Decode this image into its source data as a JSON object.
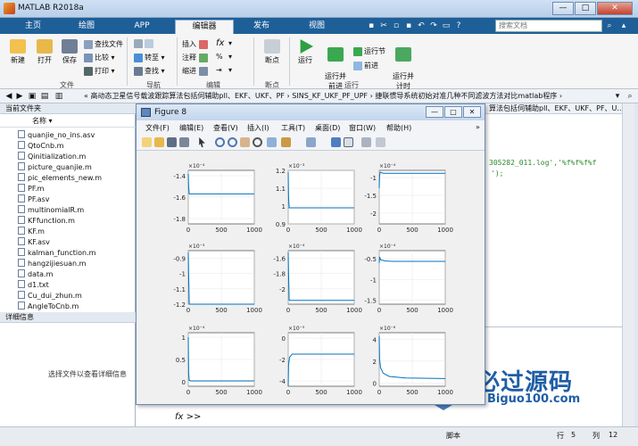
{
  "app": {
    "title": "MATLAB R2018a"
  },
  "window_controls": {
    "minimize": "—",
    "maximize": "□",
    "close": "✕"
  },
  "tabs": [
    {
      "label": "主页"
    },
    {
      "label": "绘图"
    },
    {
      "label": "APP"
    },
    {
      "label": "编辑器"
    },
    {
      "label": "发布"
    },
    {
      "label": "视图"
    }
  ],
  "search": {
    "placeholder": "搜索文档"
  },
  "ribbon": {
    "file": {
      "new": "新建",
      "open": "打开",
      "save": "保存",
      "find_files": "查找文件",
      "compare": "比较",
      "print": "打印",
      "group": "文件"
    },
    "navigate": {
      "goto": "转至",
      "find": "查找",
      "group": "导航"
    },
    "edit": {
      "insert": "插入",
      "comment": "注释",
      "indent": "缩进",
      "fx": "fx",
      "group": "编辑"
    },
    "breakpoints": {
      "label": "断点",
      "group": "断点"
    },
    "run": {
      "run": "运行",
      "run_advance": "运行并\n前进",
      "run_section": "运行节",
      "advance": "前进",
      "run_time": "运行并\n计时",
      "group": "运行"
    }
  },
  "address": {
    "path": "« 高动态卫星信号载波跟踪算法包括伺辅助pll、EKF、UKF、PF › SINS_KF_UKF_PF_UPF › 捷联惯导系统初始对准几种不同滤波方法对比matlab程序 ›"
  },
  "editor_header": "算法包括伺辅助pll、EKF、UKF、PF、U...",
  "current_folder": {
    "header": "当前文件夹",
    "column": "名称",
    "files": [
      "quanjie_no_ins.asv",
      "QtoCnb.m",
      "Qinitialization.m",
      "picture_quanjie.m",
      "pic_elements_new.m",
      "PF.m",
      "PF.asv",
      "multinomialR.m",
      "KFfunction.m",
      "KF.m",
      "KF.asv",
      "kalman_function.m",
      "hangzijiesuan.m",
      "data.m",
      "d1.txt",
      "Cu_dui_zhun.m",
      "AngleToCnb.m"
    ]
  },
  "details": {
    "header": "详细信息",
    "message": "选择文件以查看详细信息"
  },
  "editor_code": [
    "305282_011.log','%f%f%f%f",
    "');"
  ],
  "command": {
    "prompt": ">>",
    "fx": "fx"
  },
  "status": {
    "script": "脚本",
    "row_label": "行",
    "row": "5",
    "col_label": "列",
    "col": "12"
  },
  "figure": {
    "title": "Figure 8",
    "menu": [
      "文件(F)",
      "编辑(E)",
      "查看(V)",
      "插入(I)",
      "工具(T)",
      "桌面(D)",
      "窗口(W)",
      "帮助(H)"
    ]
  },
  "chart_data": [
    {
      "type": "line",
      "exponent": "×10⁻⁴",
      "yticks": [
        "-1.4",
        "-1.6",
        "-1.8"
      ],
      "xticks": [
        "0",
        "500",
        "1000"
      ],
      "ylim": [
        -1.85,
        -1.35
      ],
      "xlim": [
        0,
        1000
      ],
      "series": [
        {
          "x": [
            0,
            5,
            15,
            40,
            1000
          ],
          "y": [
            -1.38,
            -1.5,
            -1.57,
            -1.57,
            -1.57
          ]
        }
      ]
    },
    {
      "type": "line",
      "exponent": "×10⁻³",
      "yticks": [
        "1.2",
        "1.1",
        "1",
        "0.9"
      ],
      "xticks": [
        "0",
        "500",
        "1000"
      ],
      "ylim": [
        0.9,
        1.2
      ],
      "xlim": [
        0,
        1000
      ],
      "series": [
        {
          "x": [
            0,
            5,
            15,
            40,
            1000
          ],
          "y": [
            1.19,
            1.05,
            0.99,
            0.99,
            0.99
          ]
        }
      ]
    },
    {
      "type": "line",
      "exponent": "×10⁻⁴",
      "yticks": [
        "-1",
        "-1.5",
        "-2"
      ],
      "xticks": [
        "0",
        "500",
        "1000"
      ],
      "ylim": [
        -2.3,
        -0.8
      ],
      "xlim": [
        0,
        1000
      ],
      "series": [
        {
          "x": [
            0,
            5,
            15,
            60,
            1000
          ],
          "y": [
            -1.3,
            -0.95,
            -0.85,
            -0.88,
            -0.88
          ]
        }
      ]
    },
    {
      "type": "line",
      "exponent": "×10⁻³",
      "yticks": [
        "-0.9",
        "-1",
        "-1.1",
        "-1.2"
      ],
      "xticks": [
        "0",
        "500",
        "1000"
      ],
      "ylim": [
        -1.2,
        -0.85
      ],
      "xlim": [
        0,
        1000
      ],
      "series": [
        {
          "x": [
            0,
            5,
            15,
            40,
            1000
          ],
          "y": [
            -0.86,
            -1.0,
            -1.2,
            -1.2,
            -1.2
          ]
        }
      ]
    },
    {
      "type": "line",
      "exponent": "×10⁻⁴",
      "yticks": [
        "-1.6",
        "-1.8",
        "-2"
      ],
      "xticks": [
        "0",
        "500",
        "1000"
      ],
      "ylim": [
        -2.2,
        -1.5
      ],
      "xlim": [
        0,
        1000
      ],
      "series": [
        {
          "x": [
            0,
            5,
            15,
            40,
            1000
          ],
          "y": [
            -1.52,
            -1.8,
            -2.15,
            -2.15,
            -2.15
          ]
        }
      ]
    },
    {
      "type": "line",
      "exponent": "×10⁻⁴",
      "yticks": [
        "-0.5",
        "-1",
        "-1.5"
      ],
      "xticks": [
        "0",
        "500",
        "1000"
      ],
      "ylim": [
        -1.6,
        -0.3
      ],
      "xlim": [
        0,
        1000
      ],
      "series": [
        {
          "x": [
            0,
            5,
            20,
            80,
            200,
            1000
          ],
          "y": [
            -0.6,
            -0.45,
            -0.52,
            -0.55,
            -0.56,
            -0.56
          ]
        }
      ]
    },
    {
      "type": "line",
      "exponent": "×10⁻⁴",
      "yticks": [
        "1",
        "0.5",
        "0"
      ],
      "xticks": [
        "0",
        "500",
        "1000"
      ],
      "ylim": [
        -0.1,
        1.1
      ],
      "xlim": [
        0,
        1000
      ],
      "series": [
        {
          "x": [
            0,
            5,
            15,
            40,
            1000
          ],
          "y": [
            1.0,
            0.2,
            0.03,
            0.02,
            0.02
          ]
        }
      ]
    },
    {
      "type": "line",
      "exponent": "×10⁻⁵",
      "yticks": [
        "0",
        "-2",
        "-4"
      ],
      "xticks": [
        "0",
        "500",
        "1000"
      ],
      "ylim": [
        -4.5,
        0.5
      ],
      "xlim": [
        0,
        1000
      ],
      "series": [
        {
          "x": [
            0,
            5,
            20,
            60,
            150,
            1000
          ],
          "y": [
            -4.5,
            -2.5,
            -1.8,
            -1.5,
            -1.5,
            -1.5
          ]
        }
      ]
    },
    {
      "type": "line",
      "exponent": "×10⁻⁶",
      "yticks": [
        "4",
        "2",
        "0"
      ],
      "xticks": [
        "0",
        "500",
        "1000"
      ],
      "ylim": [
        -0.3,
        4.6
      ],
      "xlim": [
        0,
        1000
      ],
      "series": [
        {
          "x": [
            0,
            5,
            20,
            60,
            150,
            400,
            1000
          ],
          "y": [
            4.3,
            2.2,
            1.4,
            0.9,
            0.6,
            0.45,
            0.4
          ]
        }
      ]
    }
  ],
  "watermark": {
    "main": "必过源码",
    "sub": "Biguo100.com"
  }
}
